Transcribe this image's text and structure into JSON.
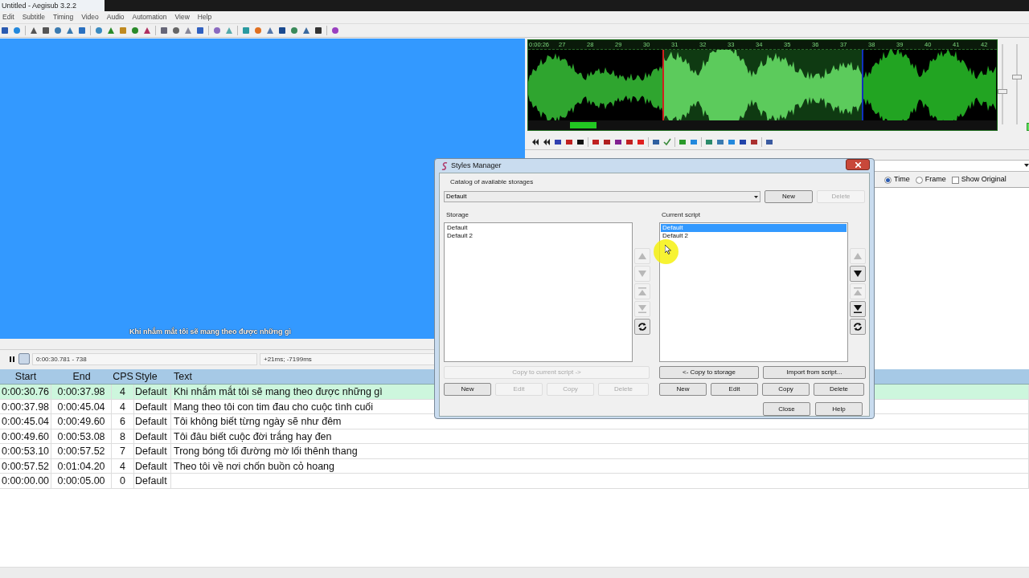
{
  "window": {
    "title": "Untitled - Aegisub 3.2.2"
  },
  "menu": [
    "Edit",
    "Subtitle",
    "Timing",
    "Video",
    "Audio",
    "Automation",
    "View",
    "Help"
  ],
  "video": {
    "subtitle": "Khi nhắm mắt tôi sẽ mang theo được những gì",
    "time": "0:00:30.781 - 738",
    "offset": "+21ms; -7199ms"
  },
  "audio": {
    "sliders": [
      {
        "level": 0.4
      },
      {
        "level": 0.6
      }
    ],
    "timeline": [
      "0:00:26",
      "27",
      "28",
      "29",
      "30",
      "31",
      "32",
      "33",
      "34",
      "35",
      "36",
      "37",
      "38",
      "39",
      "40",
      "41",
      "42"
    ]
  },
  "edit_box": {
    "time_modes": [
      {
        "label": "Time",
        "selected": true
      },
      {
        "label": "Frame",
        "selected": false
      }
    ],
    "show_original": {
      "label": "Show Original",
      "checked": false
    }
  },
  "grid": {
    "columns": [
      "Start",
      "End",
      "CPS",
      "Style",
      "Text"
    ],
    "rows": [
      {
        "start": "0:00:30.76",
        "end": "0:00:37.98",
        "cps": "4",
        "style": "Default",
        "text": "Khi nhắm mắt tôi sẽ mang theo được những gì",
        "selected": true
      },
      {
        "start": "0:00:37.98",
        "end": "0:00:45.04",
        "cps": "4",
        "style": "Default",
        "text": "Mang theo tôi con tim đau cho cuộc tình cuối",
        "selected": false
      },
      {
        "start": "0:00:45.04",
        "end": "0:00:49.60",
        "cps": "6",
        "style": "Default",
        "text": "Tôi không biết từng ngày sẽ như đêm",
        "selected": false
      },
      {
        "start": "0:00:49.60",
        "end": "0:00:53.08",
        "cps": "8",
        "style": "Default",
        "text": "Tôi đâu biết cuộc đời trắng hay đen",
        "selected": false
      },
      {
        "start": "0:00:53.10",
        "end": "0:00:57.52",
        "cps": "7",
        "style": "Default",
        "text": "Trong bóng tối đường mờ lối thênh thang",
        "selected": false
      },
      {
        "start": "0:00:57.52",
        "end": "0:01:04.20",
        "cps": "4",
        "style": "Default",
        "text": "Theo tôi về nơi chốn buồn cỏ hoang",
        "selected": false
      },
      {
        "start": "0:00:00.00",
        "end": "0:00:05.00",
        "cps": "0",
        "style": "Default",
        "text": "",
        "selected": false
      }
    ]
  },
  "dialog": {
    "title": "Styles Manager",
    "catalog_label": "Catalog of available storages",
    "catalog_value": "Default",
    "catalog_buttons": [
      {
        "label": "New",
        "disabled": false
      },
      {
        "label": "Delete",
        "disabled": true
      }
    ],
    "storage": {
      "label": "Storage",
      "items": [
        {
          "label": "Default",
          "selected": false
        },
        {
          "label": "Default 2",
          "selected": false
        }
      ],
      "arrows": [
        {
          "kind": "up",
          "disabled": true
        },
        {
          "kind": "down",
          "disabled": true
        },
        {
          "kind": "top",
          "disabled": true
        },
        {
          "kind": "bottom",
          "disabled": true
        },
        {
          "kind": "sort",
          "disabled": false
        }
      ],
      "copy_button": {
        "label": "Copy to current script ->",
        "disabled": true
      },
      "buttons": [
        {
          "label": "New",
          "disabled": false
        },
        {
          "label": "Edit",
          "disabled": true
        },
        {
          "label": "Copy",
          "disabled": true
        },
        {
          "label": "Delete",
          "disabled": true
        }
      ]
    },
    "current": {
      "label": "Current script",
      "items": [
        {
          "label": "Default",
          "selected": true
        },
        {
          "label": "Default 2",
          "selected": false
        }
      ],
      "arrows": [
        {
          "kind": "up",
          "disabled": true
        },
        {
          "kind": "down",
          "disabled": false
        },
        {
          "kind": "top",
          "disabled": true
        },
        {
          "kind": "bottom",
          "disabled": false
        },
        {
          "kind": "sort",
          "disabled": false
        }
      ],
      "copy_button": {
        "label": "<- Copy to storage",
        "disabled": false
      },
      "import_button": {
        "label": "Import from script...",
        "disabled": false
      },
      "buttons": [
        {
          "label": "New",
          "disabled": false
        },
        {
          "label": "Edit",
          "disabled": false
        },
        {
          "label": "Copy",
          "disabled": false
        },
        {
          "label": "Delete",
          "disabled": false
        }
      ]
    },
    "footer_buttons": [
      "Close",
      "Help"
    ]
  }
}
